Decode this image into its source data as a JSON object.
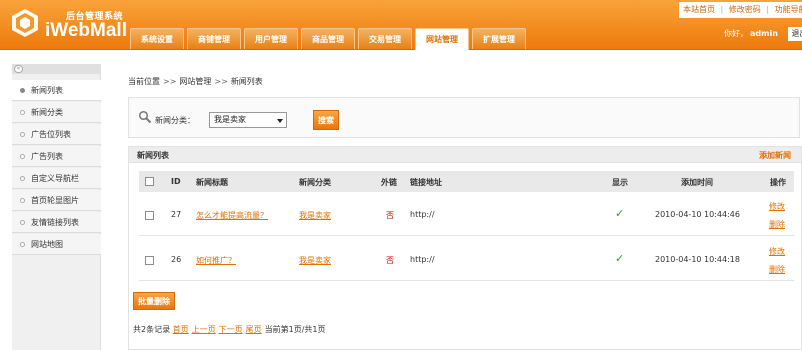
{
  "header": {
    "logo_subtitle": "后台管理系统",
    "logo_title": "iWebMall",
    "top_links": [
      "本站首页",
      "修改密码",
      "功能导航"
    ],
    "tabs": [
      "系统设置",
      "商铺管理",
      "用户管理",
      "商品管理",
      "交易管理",
      "网站管理",
      "扩展管理"
    ],
    "active_tab": "网站管理",
    "greeting": "你好，",
    "username": "admin",
    "logout": "退出"
  },
  "sidebar": {
    "items": [
      {
        "label": "新闻列表",
        "active": true
      },
      {
        "label": "新闻分类",
        "active": false
      },
      {
        "label": "广告位列表",
        "active": false
      },
      {
        "label": "广告列表",
        "active": false
      },
      {
        "label": "自定义导航栏",
        "active": false
      },
      {
        "label": "首页轮显图片",
        "active": false
      },
      {
        "label": "友情链接列表",
        "active": false
      },
      {
        "label": "网站地图",
        "active": false
      }
    ]
  },
  "breadcrumb": [
    "当前位置",
    "网站管理",
    "新闻列表"
  ],
  "search": {
    "label": "新闻分类：",
    "selected_category": "我是卖家",
    "button": "搜索"
  },
  "list": {
    "title": "新闻列表",
    "add_link": "添加新闻",
    "columns": [
      "ID",
      "新闻标题",
      "新闻分类",
      "外链",
      "链接地址",
      "显示",
      "添加时间",
      "操作"
    ],
    "rows": [
      {
        "id": "27",
        "title": "怎么才能提高流量？",
        "category": "我是卖家",
        "external": "否",
        "url": "http://",
        "display": "✓",
        "added": "2010-04-10 10:44:46",
        "edit": "修改",
        "delete": "删除"
      },
      {
        "id": "26",
        "title": "如何推广？",
        "category": "我是卖家",
        "external": "否",
        "url": "http://",
        "display": "✓",
        "added": "2010-04-10 10:44:18",
        "edit": "修改",
        "delete": "删除"
      }
    ],
    "batch_delete": "批量删除",
    "pager": {
      "total": "共2条记录",
      "first": "首页",
      "prev": "上一页",
      "next": "下一页",
      "last": "尾页",
      "current": "当前第1页/共1页"
    }
  },
  "colors": {
    "accent": "#ee7a0c",
    "link": "#e36f00",
    "check": "#2a9a2a",
    "no": "#d40000"
  }
}
